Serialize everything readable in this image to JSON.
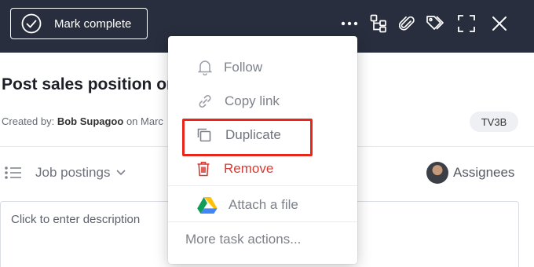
{
  "toolbar": {
    "mark_complete_label": "Mark complete",
    "icons": [
      "more-icon",
      "subtasks-icon",
      "attachment-icon",
      "tags-icon",
      "fullscreen-icon",
      "close-icon"
    ]
  },
  "task": {
    "title": "Post sales position on",
    "created_prefix": "Created by:",
    "created_by": "Bob Supagoo",
    "created_suffix": " on Marc",
    "id_badge": "TV3B",
    "project": "Job postings",
    "assignees_label": "Assignees",
    "description_placeholder": "Click to enter description"
  },
  "menu": {
    "follow": "Follow",
    "copy_link": "Copy link",
    "duplicate": "Duplicate",
    "remove": "Remove",
    "attach_file": "Attach a file",
    "more_actions": "More task actions..."
  },
  "colors": {
    "topbar_bg": "#282e3d",
    "remove_red": "#d63b33",
    "highlight_red": "#e8251b"
  }
}
